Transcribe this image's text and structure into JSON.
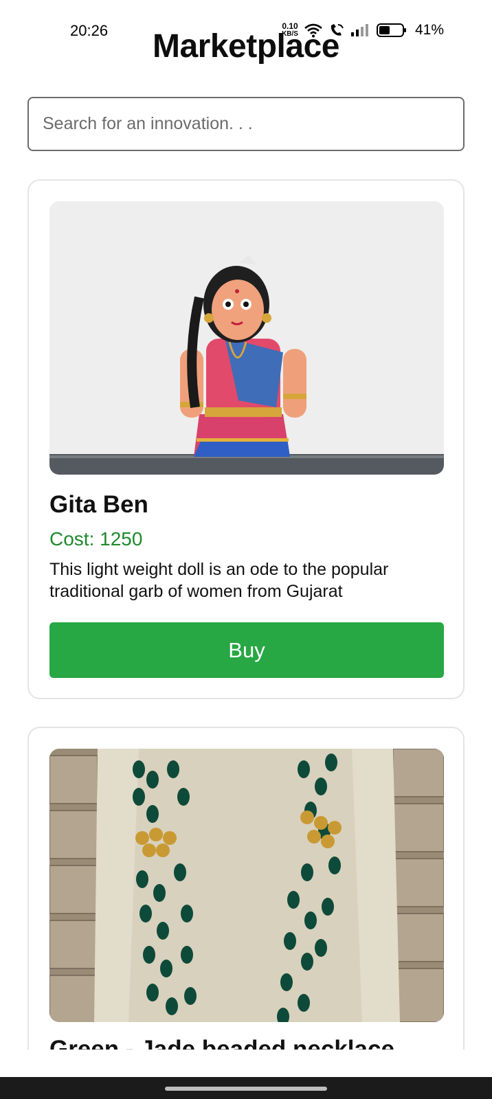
{
  "status_bar": {
    "time": "20:26",
    "net_speed_value": "0.10",
    "net_speed_unit": "KB/S",
    "battery_percent": "41%",
    "icons": [
      "wifi-icon",
      "wifi-call-icon",
      "signal-icon",
      "battery-icon"
    ]
  },
  "header": {
    "title": "Marketplace"
  },
  "search": {
    "placeholder": "Search for an innovation. . ."
  },
  "products": [
    {
      "name": "Gita Ben",
      "cost": "Cost: 1250",
      "description": "This light weight doll is an ode to the popular traditional garb of women from Gujarat",
      "button": "Buy"
    },
    {
      "name": "Green - Jade beaded necklace"
    }
  ],
  "colors": {
    "accent_green": "#28a745",
    "cost_green": "#1e8a2d",
    "card_border": "#e4e4e4",
    "nav_bar": "#1b1b1b"
  }
}
